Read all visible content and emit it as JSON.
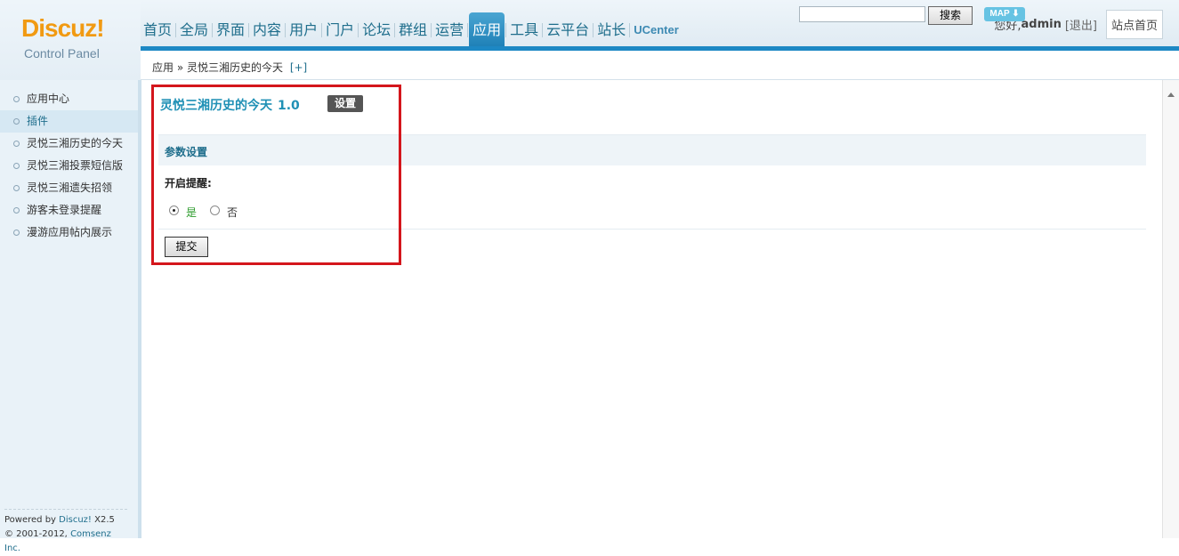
{
  "logo": {
    "brand": "Discuz!",
    "subtitle": "Control Panel"
  },
  "nav": {
    "tabs": [
      "首页",
      "全局",
      "界面",
      "内容",
      "用户",
      "门户",
      "论坛",
      "群组",
      "运营",
      "应用",
      "工具",
      "云平台",
      "站长",
      "UCenter"
    ],
    "active": "应用"
  },
  "user": {
    "greeting": "您好,",
    "name": "admin",
    "logout": "[退出]",
    "home_button": "站点首页"
  },
  "breadcrumb": {
    "path": "应用 » 灵悦三湘历史的今天",
    "add": "[+]"
  },
  "search": {
    "placeholder": "",
    "button": "搜索",
    "map": "MAP ⬇"
  },
  "sidebar": {
    "items": [
      {
        "label": "应用中心"
      },
      {
        "label": "插件"
      },
      {
        "label": "灵悦三湘历史的今天"
      },
      {
        "label": "灵悦三湘投票短信版"
      },
      {
        "label": "灵悦三湘遗失招领"
      },
      {
        "label": "游客未登录提醒"
      },
      {
        "label": "漫游应用帖内展示"
      }
    ],
    "active_index": 1,
    "powered_line1": "Powered by",
    "powered_brand": "Discuz!",
    "powered_version": " X2.5",
    "copyright_prefix": "© 2001-2012,",
    "copyright_link": "Comsenz Inc."
  },
  "main": {
    "plugin_name": "灵悦三湘历史的今天",
    "plugin_version": "1.0",
    "setting_badge": "设置",
    "section_title": "参数设置",
    "option_label": "开启提醒:",
    "option_yes": "是",
    "option_no": "否",
    "option_selected": "是",
    "submit_label": "提交"
  },
  "colors": {
    "accent": "#1d88c4",
    "highlight": "#d4161c",
    "logo": "#f19a12"
  }
}
